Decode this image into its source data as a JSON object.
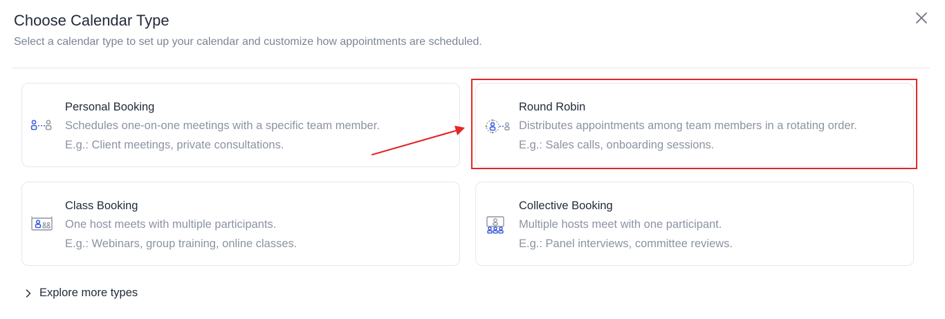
{
  "header": {
    "title": "Choose Calendar Type",
    "subtitle": "Select a calendar type to set up your calendar and customize how appointments are scheduled."
  },
  "cards": [
    {
      "title": "Personal Booking",
      "description": "Schedules one-on-one meetings with a specific team member.",
      "example": "E.g.: Client meetings, private consultations.",
      "icon": "one-to-one-icon"
    },
    {
      "title": "Round Robin",
      "description": "Distributes appointments among team members in a rotating order.",
      "example": "E.g.: Sales calls, onboarding sessions.",
      "icon": "round-robin-icon"
    },
    {
      "title": "Class Booking",
      "description": "One host meets with multiple participants.",
      "example": "E.g.: Webinars, group training, online classes.",
      "icon": "class-icon"
    },
    {
      "title": "Collective Booking",
      "description": "Multiple hosts meet with one participant.",
      "example": "E.g.: Panel interviews, committee reviews.",
      "icon": "collective-icon"
    }
  ],
  "footer": {
    "explore_label": "Explore more types"
  },
  "colors": {
    "accent_blue": "#3b5bdb",
    "annotation_red": "#e32626",
    "title_text": "#1f2937",
    "muted_text": "#8b93a1"
  }
}
